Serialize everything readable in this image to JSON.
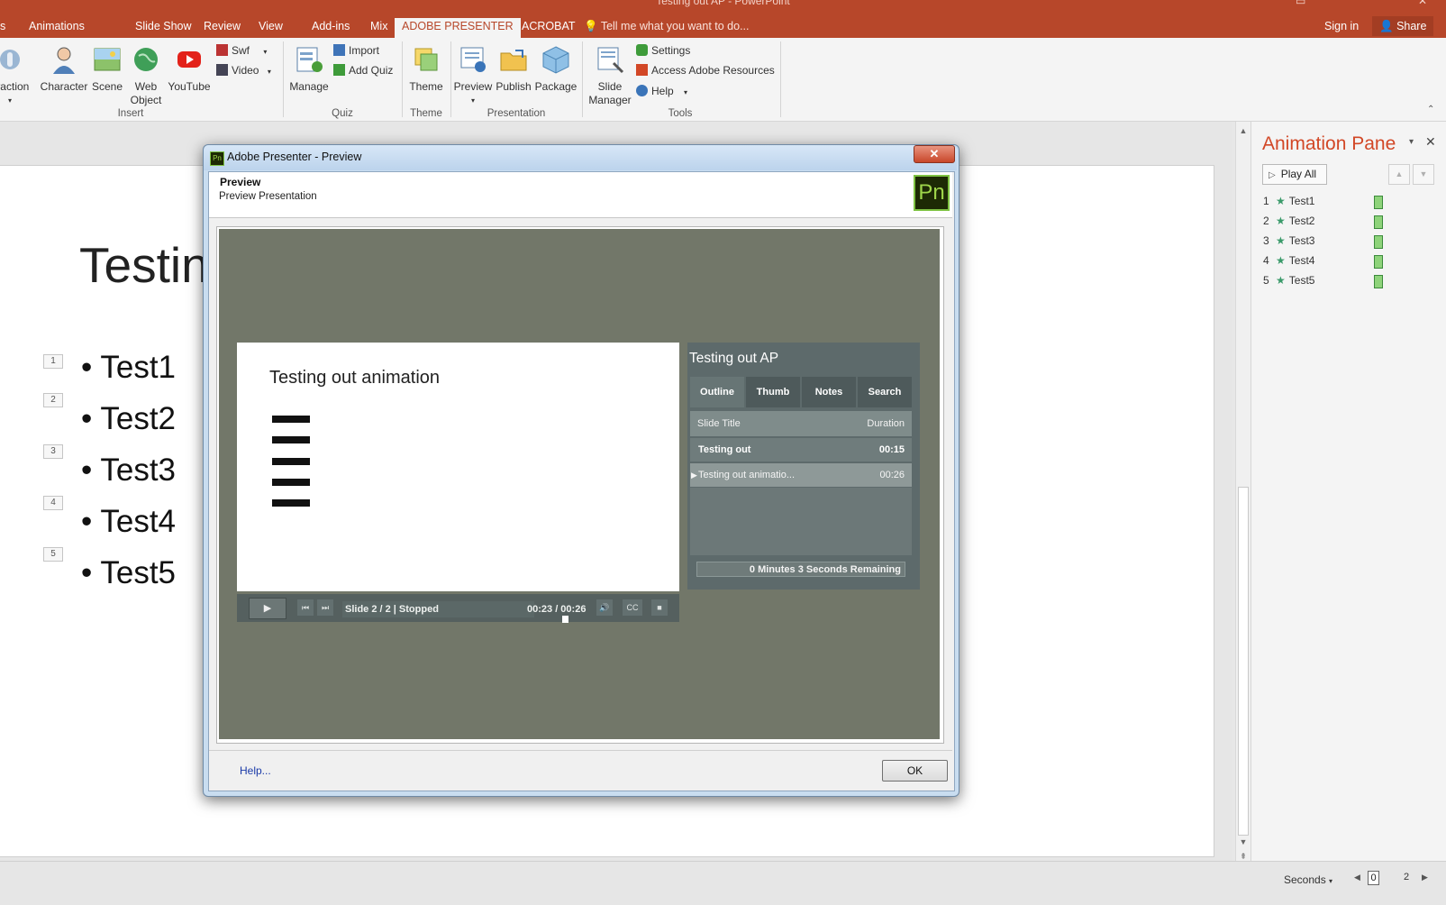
{
  "window": {
    "title": "Testing out AP - PowerPoint"
  },
  "tabs": [
    "s",
    "Animations",
    "Slide Show",
    "Review",
    "View",
    "Add-ins",
    "Mix",
    "ADOBE PRESENTER",
    "ACROBAT"
  ],
  "tell_me": "Tell me what you want to do...",
  "sign_in": "Sign in",
  "share": "Share",
  "ribbon": {
    "insert": {
      "label": "Insert",
      "buttons": [
        "eraction",
        "Character",
        "Scene",
        "Web Object",
        "YouTube"
      ],
      "small": [
        "Swf",
        "Video"
      ]
    },
    "quiz": {
      "label": "Quiz",
      "manage": "Manage",
      "import": "Import",
      "add_quiz": "Add Quiz"
    },
    "theme": {
      "label": "Theme",
      "theme": "Theme"
    },
    "presentation": {
      "label": "Presentation",
      "preview": "Preview",
      "publish": "Publish",
      "package": "Package"
    },
    "tools": {
      "label": "Tools",
      "slide_manager": "Slide Manager",
      "settings": "Settings",
      "access": "Access Adobe Resources",
      "help": "Help"
    }
  },
  "slide": {
    "title": "Testin",
    "bullets": [
      "Test1",
      "Test2",
      "Test3",
      "Test4",
      "Test5"
    ],
    "anim_tags": [
      "1",
      "2",
      "3",
      "4",
      "5"
    ]
  },
  "animation_pane": {
    "title": "Animation Pane",
    "play_all": "Play All",
    "items": [
      {
        "num": "1",
        "name": "Test1"
      },
      {
        "num": "2",
        "name": "Test2"
      },
      {
        "num": "3",
        "name": "Test3"
      },
      {
        "num": "4",
        "name": "Test4"
      },
      {
        "num": "5",
        "name": "Test5"
      }
    ],
    "seconds": "Seconds",
    "timeline_start": "0",
    "timeline_end": "2"
  },
  "dialog": {
    "title": "Adobe Presenter - Preview",
    "header": "Preview",
    "subheader": "Preview Presentation",
    "logo": "Pn",
    "help": "Help...",
    "ok": "OK"
  },
  "player": {
    "slide_title": "Testing out animation",
    "status": "Slide 2 / 2 | Stopped",
    "time": "00:23 / 00:26",
    "cc": "CC",
    "panel_title": "Testing out AP",
    "tabs": [
      "Outline",
      "Thumb",
      "Notes",
      "Search"
    ],
    "col_title": "Slide Title",
    "col_duration": "Duration",
    "rows": [
      {
        "title": "Testing out",
        "duration": "00:15"
      },
      {
        "title": "Testing out animatio...",
        "duration": "00:26"
      }
    ],
    "remaining": "0 Minutes 3 Seconds Remaining"
  },
  "colors": {
    "accent": "#b7472a",
    "pane_title": "#d24726",
    "player_bg": "#727769"
  }
}
